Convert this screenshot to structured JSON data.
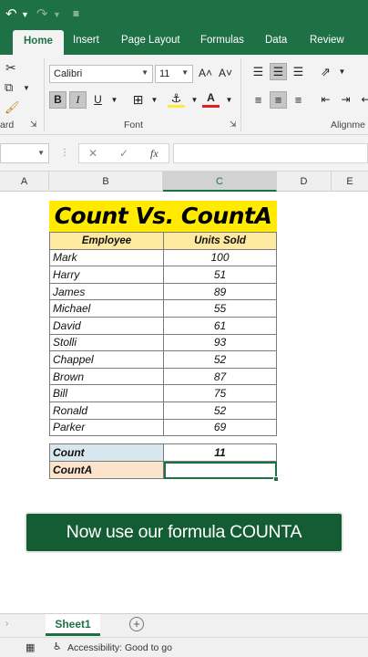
{
  "ribbon": {
    "tabs": [
      "Home",
      "Insert",
      "Page Layout",
      "Formulas",
      "Data",
      "Review"
    ],
    "active_tab": "Home",
    "font_name": "Calibri",
    "font_size": "11",
    "group_clipboard": "ard",
    "group_font": "Font",
    "group_alignment": "Alignme",
    "grow_font": "A˄",
    "shrink_font": "A˅",
    "bold": "B",
    "italic": "I",
    "underline": "U",
    "font_color": "A"
  },
  "formula_bar": {
    "name_box": "",
    "fx": "fx",
    "content": ""
  },
  "columns": [
    "A",
    "B",
    "C",
    "D",
    "E"
  ],
  "sheet": {
    "title": "Count Vs. CountA",
    "headers": [
      "Employee",
      "Units Sold"
    ],
    "rows": [
      [
        "Mark",
        "100"
      ],
      [
        "Harry",
        "51"
      ],
      [
        "James",
        "89"
      ],
      [
        "Michael",
        "55"
      ],
      [
        "David",
        "61"
      ],
      [
        "Stolli",
        "93"
      ],
      [
        "Chappel",
        "52"
      ],
      [
        "Brown",
        "87"
      ],
      [
        "Bill",
        "75"
      ],
      [
        "Ronald",
        "52"
      ],
      [
        "Parker",
        "69"
      ]
    ],
    "summary": [
      {
        "label": "Count",
        "value": "11"
      },
      {
        "label": "CountA",
        "value": ""
      }
    ]
  },
  "caption": "Now use our formula COUNTA",
  "sheet_tabs": [
    "Sheet1"
  ],
  "status": {
    "accessibility": "Accessibility: Good to go"
  },
  "colors": {
    "excel_green": "#1e7145",
    "title_fill": "#ffea00",
    "header_fill": "#fde9a0",
    "count_fill": "#d8e6ee",
    "counta_fill": "#fbe3cc",
    "caption_fill": "#145c33"
  }
}
